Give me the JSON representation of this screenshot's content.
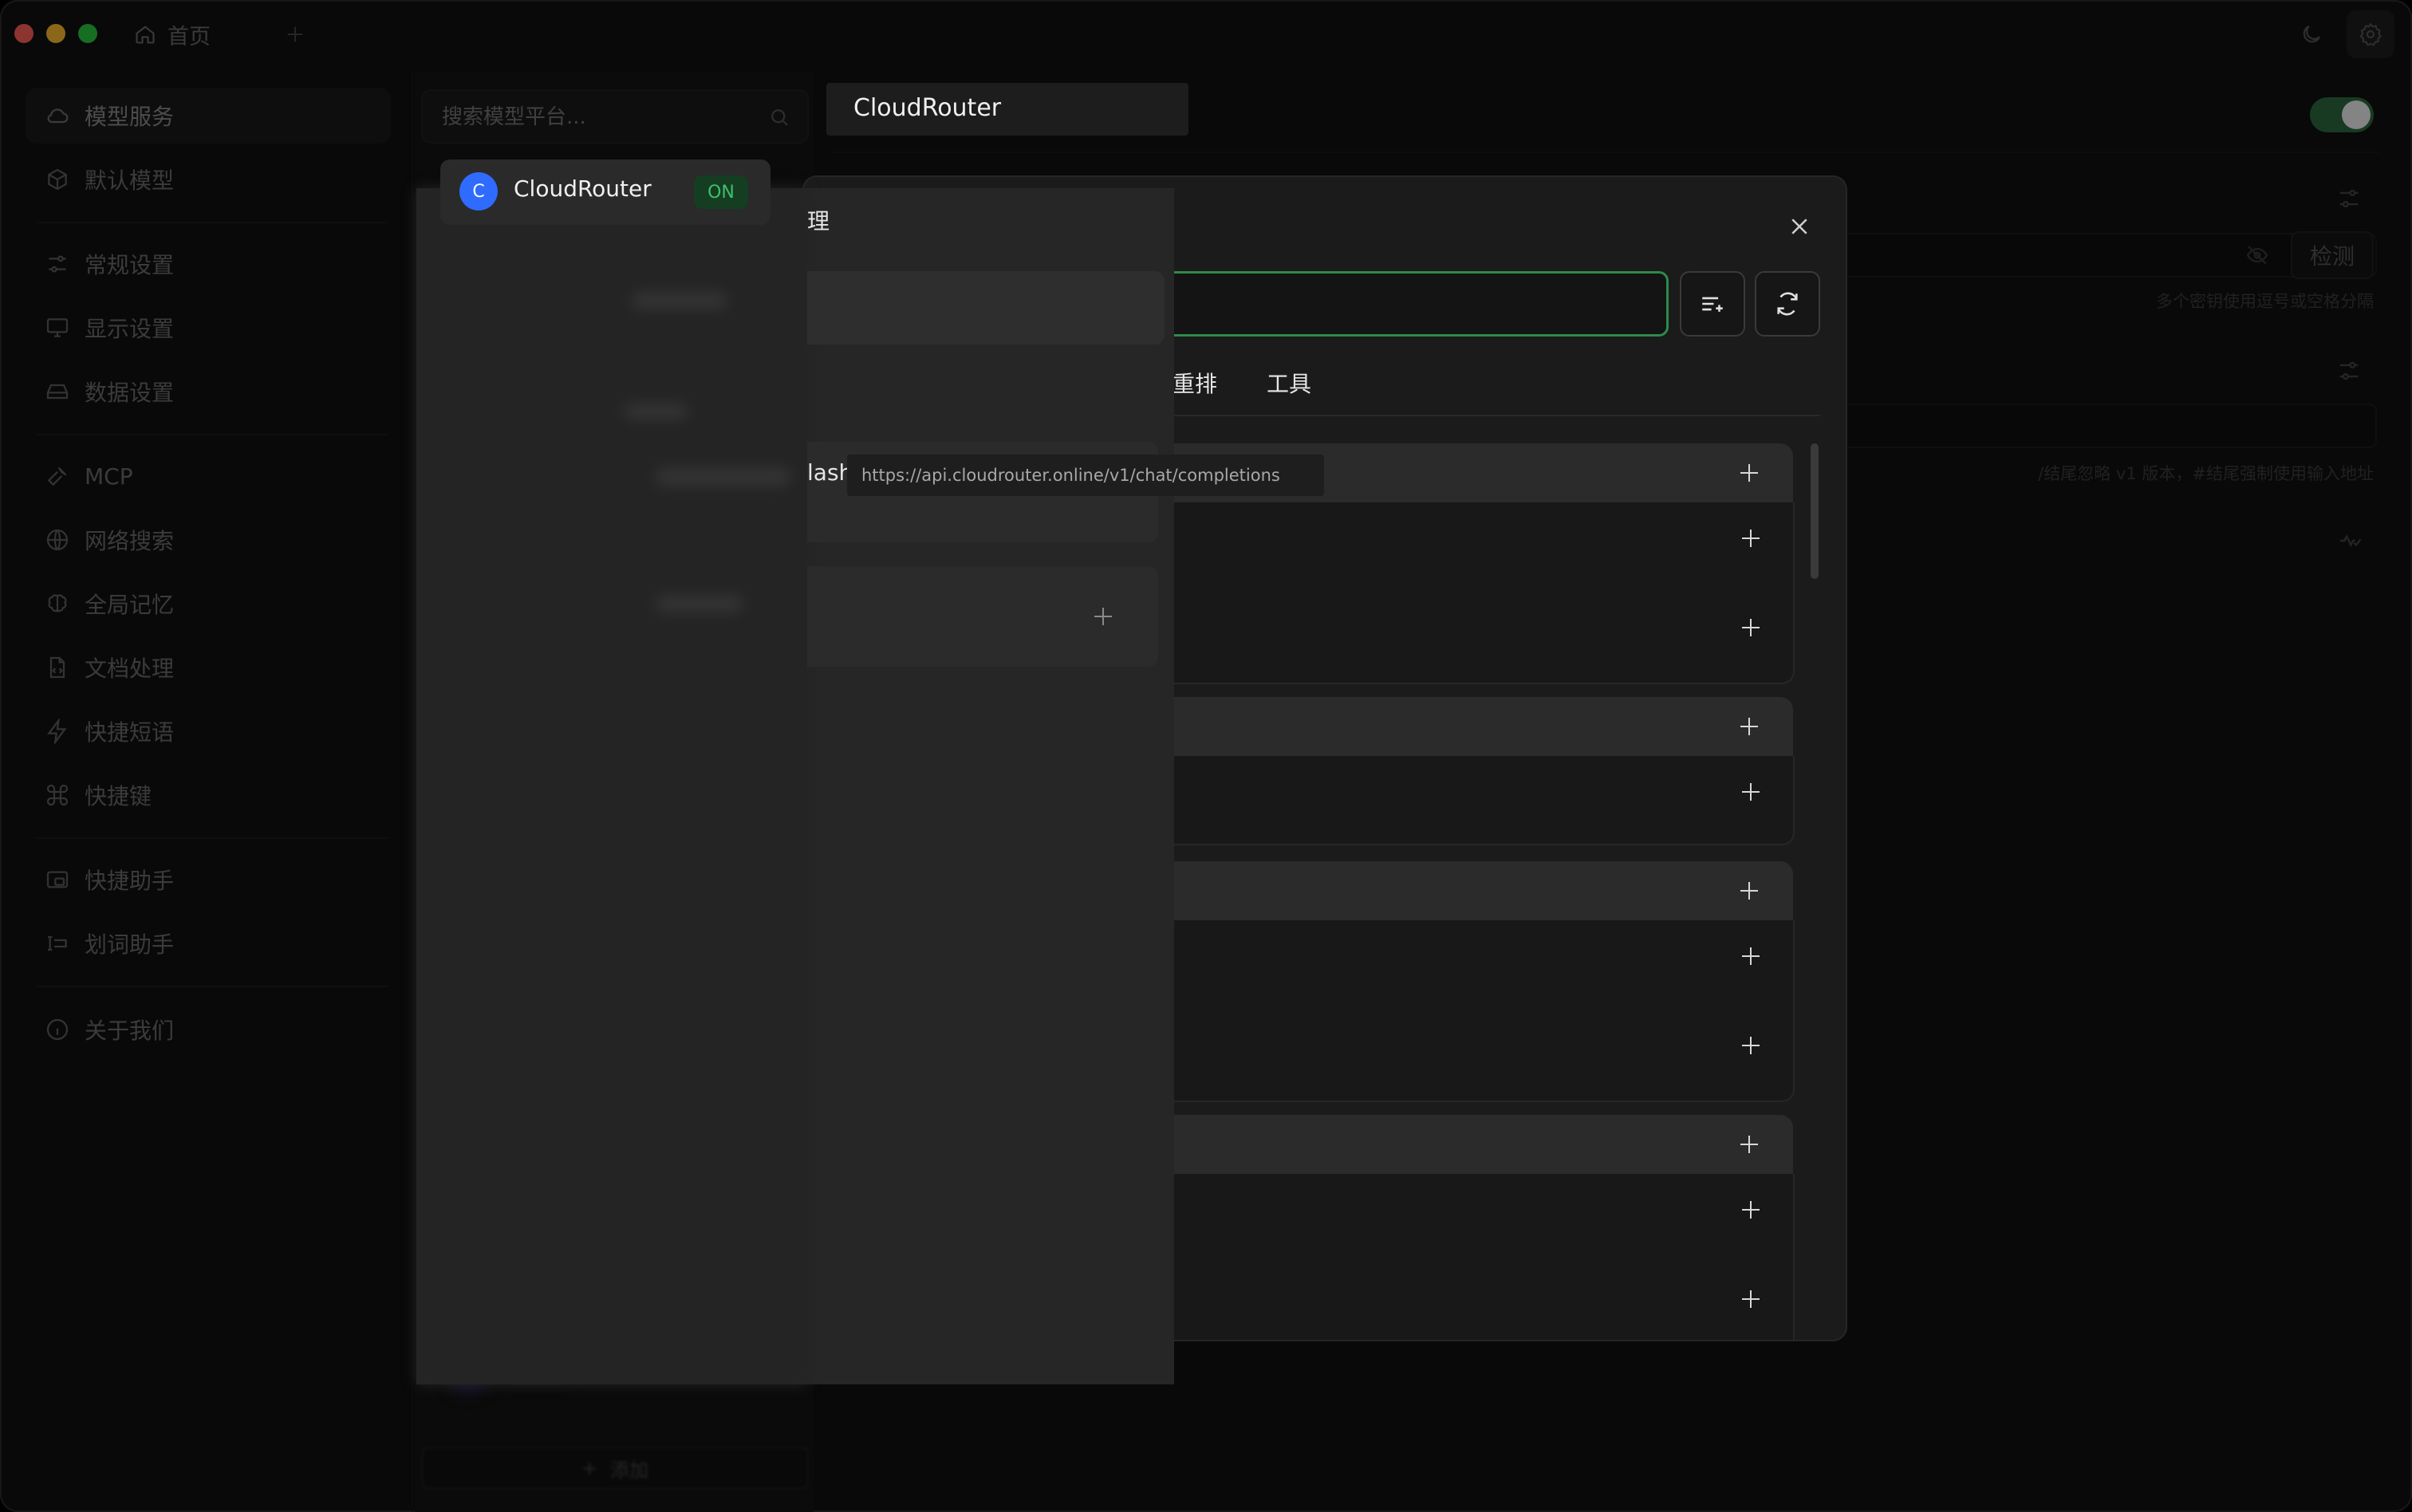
{
  "titlebar": {
    "home_tab_label": "首页",
    "colors": {
      "close": "#ff5f57",
      "minimize": "#febc2e",
      "zoom": "#28c840"
    }
  },
  "sidebar": {
    "items": [
      {
        "label": "模型服务",
        "icon": "cloud-icon",
        "active": true
      },
      {
        "label": "默认模型",
        "icon": "cube-icon"
      },
      {
        "label": "常规设置",
        "icon": "sliders-icon"
      },
      {
        "label": "显示设置",
        "icon": "monitor-icon"
      },
      {
        "label": "数据设置",
        "icon": "drive-icon"
      },
      {
        "label": "MCP",
        "icon": "hammer-icon"
      },
      {
        "label": "网络搜索",
        "icon": "globe-icon"
      },
      {
        "label": "全局记忆",
        "icon": "brain-icon"
      },
      {
        "label": "文档处理",
        "icon": "document-icon"
      },
      {
        "label": "快捷短语",
        "icon": "zap-icon"
      },
      {
        "label": "快捷键",
        "icon": "command-icon"
      },
      {
        "label": "快捷助手",
        "icon": "app-window-icon"
      },
      {
        "label": "划词助手",
        "icon": "text-select-icon"
      },
      {
        "label": "关于我们",
        "icon": "info-icon"
      }
    ]
  },
  "providers": {
    "search_placeholder": "搜索模型平台...",
    "selected": {
      "name": "CloudRouter",
      "avatar_letter": "C",
      "status": "ON",
      "avatar_color": "#2f6bff"
    },
    "add_label": "添加"
  },
  "detail": {
    "title": "CloudRouter",
    "api_key_check_label": "检测",
    "api_key_hint": "多个密钥使用逗号或空格分隔",
    "api_host_hint": "/结尾忽略 v1 版本，#结尾强制使用输入地址"
  },
  "modal": {
    "tabs": {
      "rerank": "重排",
      "tools": "工具"
    }
  },
  "front_panel": {
    "title_fragment": "理",
    "flash_fragment": "lash"
  },
  "tooltip": {
    "text": "https://api.cloudrouter.online/v1/chat/completions"
  },
  "colors": {
    "accent_green": "#2e8a4a",
    "on_badge_bg": "#153d22",
    "on_badge_text": "#3fbf6a"
  }
}
